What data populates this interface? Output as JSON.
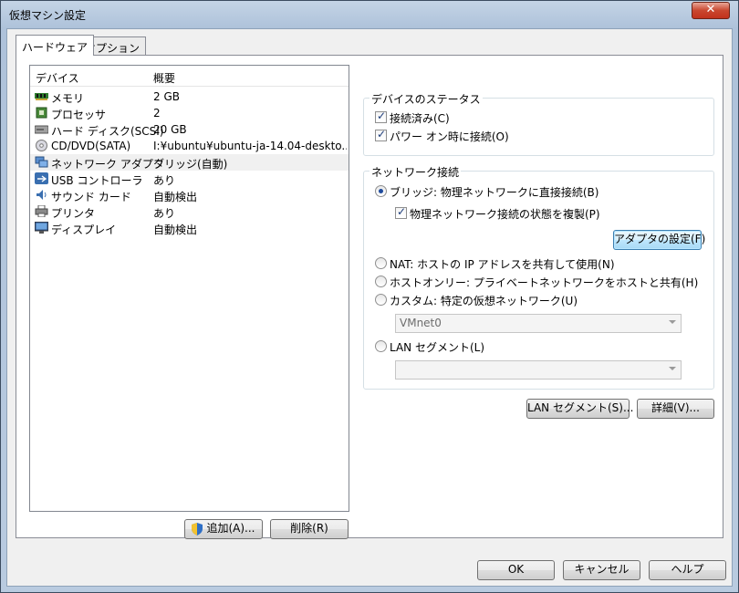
{
  "window": {
    "title": "仮想マシン設定",
    "close_label": "✕"
  },
  "tabs": [
    {
      "label": "ハードウェア"
    },
    {
      "label": "オプション"
    }
  ],
  "device_list": {
    "columns": {
      "device": "デバイス",
      "summary": "概要"
    },
    "rows": [
      {
        "name": "メモリ",
        "summary": "2 GB",
        "icon": "memory-icon"
      },
      {
        "name": "プロセッサ",
        "summary": "2",
        "icon": "processor-icon"
      },
      {
        "name": "ハード ディスク(SCSI)",
        "summary": "20 GB",
        "icon": "hard-disk-icon"
      },
      {
        "name": "CD/DVD(SATA)",
        "summary": "I:¥ubuntu¥ubuntu-ja-14.04-deskto...",
        "icon": "cd-dvd-icon"
      },
      {
        "name": "ネットワーク アダプタ",
        "summary": "ブリッジ(自動)",
        "icon": "network-adapter-icon",
        "selected": true
      },
      {
        "name": "USB コントローラ",
        "summary": "あり",
        "icon": "usb-icon"
      },
      {
        "name": "サウンド カード",
        "summary": "自動検出",
        "icon": "sound-card-icon"
      },
      {
        "name": "プリンタ",
        "summary": "あり",
        "icon": "printer-icon"
      },
      {
        "name": "ディスプレイ",
        "summary": "自動検出",
        "icon": "display-icon"
      }
    ]
  },
  "list_buttons": {
    "add": "追加(A)...",
    "remove": "削除(R)"
  },
  "device_status": {
    "title": "デバイスのステータス",
    "connected": {
      "label": "接続済み(C)",
      "checked": true
    },
    "connect_at_power_on": {
      "label": "パワー オン時に接続(O)",
      "checked": true
    }
  },
  "network": {
    "title": "ネットワーク接続",
    "bridged": {
      "label": "ブリッジ: 物理ネットワークに直接接続(B)",
      "selected": true
    },
    "replicate": {
      "label": "物理ネットワーク接続の状態を複製(P)",
      "checked": true
    },
    "configure_adapters": "アダプタの設定(F)",
    "nat": {
      "label": "NAT: ホストの IP アドレスを共有して使用(N)"
    },
    "host_only": {
      "label": "ホストオンリー: プライベートネットワークをホストと共有(H)"
    },
    "custom": {
      "label": "カスタム: 特定の仮想ネットワーク(U)"
    },
    "custom_select": "VMnet0",
    "lan_segment": {
      "label": "LAN セグメント(L)"
    },
    "lan_segment_select": ""
  },
  "right_buttons": {
    "lan_segments": "LAN セグメント(S)...",
    "advanced": "詳細(V)..."
  },
  "dialog_buttons": {
    "ok": "OK",
    "cancel": "キャンセル",
    "help": "ヘルプ"
  }
}
